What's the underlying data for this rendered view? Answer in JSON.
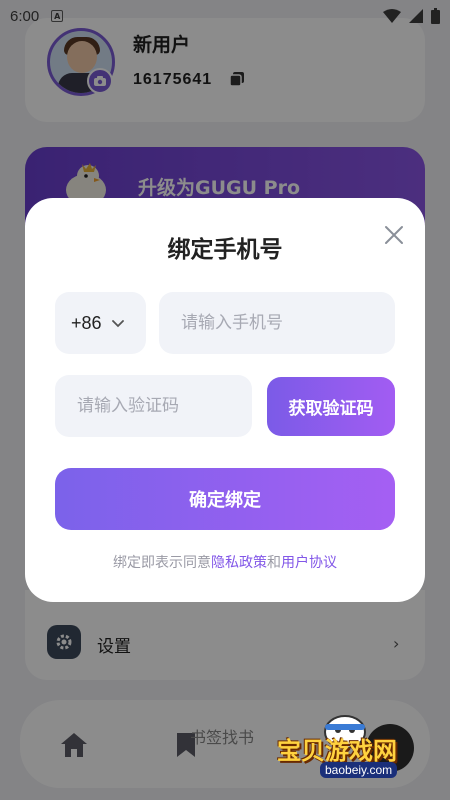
{
  "status_bar": {
    "time": "6:00",
    "app_badge": "A"
  },
  "profile": {
    "username": "新用户",
    "user_id": "16175641"
  },
  "pro_banner": {
    "title": "升级为GUGU Pro"
  },
  "menu": {
    "settings_label": "设置",
    "chevron": "›"
  },
  "bottom_nav": {
    "hidden_label": "书签找书"
  },
  "bind_dialog": {
    "title": "绑定手机号",
    "country_code": "+86",
    "phone_placeholder": "请输入手机号",
    "code_placeholder": "请输入验证码",
    "get_code_label": "获取验证码",
    "confirm_label": "确定绑定",
    "agreement_prefix": "绑定即表示同意",
    "privacy_link": "隐私政策",
    "agreement_and": "和",
    "terms_link": "用户协议"
  },
  "watermark": {
    "text": "宝贝游戏网",
    "url": "baobeiy.com"
  },
  "colors": {
    "accent": "#8257e8",
    "button_start": "#7b5be7",
    "button_end": "#a25cf2",
    "input_bg": "#f1f3f8"
  }
}
